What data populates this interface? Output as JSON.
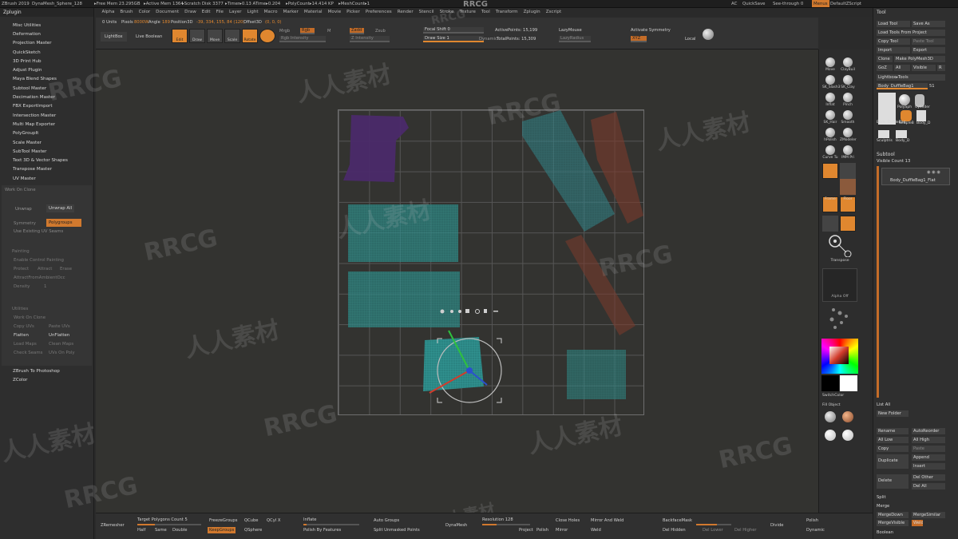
{
  "titlebar": {
    "items": [
      "ZBrush 2019",
      "DynaMesh_Sphere_128",
      "▸Free Mem 23.295GB",
      "▸Active Mem 1364",
      "▸Scratch Disk 3377",
      "▸Timer▸0.13 ATime▸0.204",
      "▸PolyCount▸14.414 KP",
      "▸MeshCount▸1"
    ],
    "center_watermark": "RRCG",
    "ac": "AC",
    "quicksave": "QuickSave",
    "seethrough": "See-through 0",
    "menus": "Menus",
    "defaultscript": "DefaultZScript"
  },
  "menubar": [
    "Alpha",
    "Brush",
    "Color",
    "Document",
    "Draw",
    "Edit",
    "File",
    "Layer",
    "Light",
    "Macro",
    "Marker",
    "Material",
    "Movie",
    "Picker",
    "Preferences",
    "Render",
    "Stencil",
    "Stroke",
    "Texture",
    "Tool",
    "Transform",
    "Zplugin",
    "Zscript"
  ],
  "leftpanel": {
    "header": "Zplugin",
    "plugins": [
      "Misc Utilities",
      "Deformation",
      "Projection Master",
      "QuickSketch",
      "3D Print Hub",
      "Adjust Plugin",
      "Maya Blend Shapes",
      "Subtool Master",
      "Decimation Master",
      "FBX ExportImport",
      "Intersection Master",
      "Multi Map Exporter",
      "PolyGroupIt",
      "Scale Master",
      "SubTool Master",
      "Text 3D & Vector Shapes",
      "Transpose Master",
      "UV Master"
    ],
    "uv": {
      "workon_clone": "Work On Clone",
      "flatten": "Flatten",
      "unflatten": "UnFlatten",
      "unwrap": "Unwrap",
      "unwrap_all": "Unwrap All",
      "symmetry": "Symmetry",
      "polygroups": "Polygroups",
      "use_existing": "Use Existing UV Seams",
      "painting": "Painting",
      "enable_control": "Enable Control Painting",
      "protect": "Protect",
      "attract": "Attract",
      "erase": "Erase",
      "density": "Density",
      "attract_ambient": "AttractFromAmbientOcc",
      "density_val": "1",
      "utilities": "Utilities",
      "work_on_clone": "Work On Clone",
      "copy_uvs": "Copy UVs",
      "paste_uvs": "Paste UVs",
      "flatten2": "Flatten",
      "unflatten2": "UnFlatten",
      "load_maps": "Load Maps",
      "clean_maps": "Clean Maps",
      "check_seams": "Check Seams",
      "uvs_on_poly": "UVs On Poly"
    },
    "bottom": [
      "ZBrush To Photoshop",
      "ZColor"
    ]
  },
  "shelf": {
    "lightbox": "LightBox",
    "livebool": "Live Boolean",
    "edit": "Edit",
    "draw": "Draw",
    "move": "Move",
    "scale": "Scale",
    "rotate": "Rotate",
    "mrgb": "Mrgb",
    "rgb": "Rgb",
    "m": "M",
    "zadd": "Zadd",
    "zsub": "Zsub",
    "rgb_intensity": "Rgb Intensity",
    "z_intensity": "Z Intensity",
    "focal_shift": "Focal Shift 0",
    "draw_size": "Draw Size 1",
    "dynamic": "Dynamic",
    "active_points": "ActivePoints: 15,199",
    "total_points": "TotalPoints: 15,309",
    "activate_symmetry": "Activate Symmetry",
    "local": "Local",
    "lazymouse": "LazyMouse",
    "lazyradius": "LazyRadius",
    "xyz": "XYZ",
    "units": "0 Units",
    "pixols": "Pixols",
    "pixol_val": "8000W",
    "angle": "Angle",
    "angle_val": "189",
    "position3d": "Position3D",
    "position_val": "-39, 334, 155, 84 (120)",
    "offset3d": "Offset3D",
    "offset_val": "(0, 0, 0)"
  },
  "rtools": [
    "Move",
    "ClayBuil",
    "SK_Slash3",
    "SK_Clay",
    "Inflat",
    "Pinch",
    "SK_Hair",
    "Smooth",
    "hPolish",
    "ZModeler",
    "Curve Tu",
    "IMM Pri",
    "Frame",
    "Floor",
    "Transpose",
    "Alpha Off",
    "SwitchColor",
    "Fill Object"
  ],
  "rpanel": {
    "tool": "Tool",
    "load_tool": "Load Tool",
    "save_as": "Save As",
    "load_from_project": "Load Tools From Project",
    "copy_tool": "Copy Tool",
    "paste_tool": "Paste Tool",
    "import": "Import",
    "export": "Export",
    "clone": "Clone",
    "make_polymesh": "Make PolyMesh3D",
    "goz": "GoZ",
    "all": "All",
    "visible": "Visible",
    "r": "R",
    "lightbox_tools": "Lightbox▸Tools",
    "body_current": "Body_DuffleBag1",
    "body_count": "51",
    "thumbs": [
      "Body_DuffleBag",
      "PolySph",
      "Cylinder",
      "SimpleB",
      "Body_D",
      "Sculptris",
      "Body_D"
    ],
    "subtool": "Subtool",
    "visible_count": "Visible Count 13",
    "subtool_item": "Body_DuffleBag1_Flat",
    "split": "Split",
    "merge": "Merge",
    "boolean": "Boolean",
    "new_folder": "New Folder",
    "list_all": "List All",
    "rename": "Rename",
    "auto_reorder": "AutoReorder",
    "all_low": "All Low",
    "all_high": "All High",
    "copy": "Copy",
    "paste": "Paste",
    "duplicate": "Duplicate",
    "append": "Append",
    "insert": "Insert",
    "delete": "Delete",
    "del_other": "Del Other",
    "del_all": "Del All",
    "merge_down": "MergeDown",
    "merge_similar": "MergeSimilar",
    "merge_visible": "MergeVisible",
    "weld": "Weld"
  },
  "bottom": {
    "zremesher": "ZRemesher",
    "target_poly": "Target Polygons Count 5",
    "half": "Half",
    "same": "Same",
    "double": "Double",
    "freeze_groups": "FreezeGroups",
    "keep_groups": "KeepGroups",
    "qcube": "QCube",
    "qsphere": "QSphere",
    "qcyl": "QCyl X",
    "inflate": "Inflate",
    "polish_features": "Polish By Features",
    "auto_groups": "Auto Groups",
    "split_unmasked": "Split Unmasked Points",
    "dynamesh": "DynaMesh",
    "resolution": "Resolution 128",
    "project": "Project",
    "polish": "Polish",
    "close_holes": "Close Holes",
    "mirror_weld": "Mirror And Weld",
    "mirror": "Mirror",
    "weld": "Weld",
    "backface_mask": "BackfaceMask",
    "del_hidden": "Del Hidden",
    "divide": "Divide",
    "polish_dyna": "Polish",
    "dynamic": "Dynamic",
    "sdiv": "SDiv",
    "del_lower": "Del Lower",
    "del_higher": "Del Higher"
  },
  "watermarks": [
    "RRCG",
    "人人素材"
  ],
  "colors": {
    "accent": "#e0872f",
    "uv_teal": "#2c8f8d",
    "uv_purple": "#4c2a6b",
    "uv_red": "#7a3b2b"
  }
}
